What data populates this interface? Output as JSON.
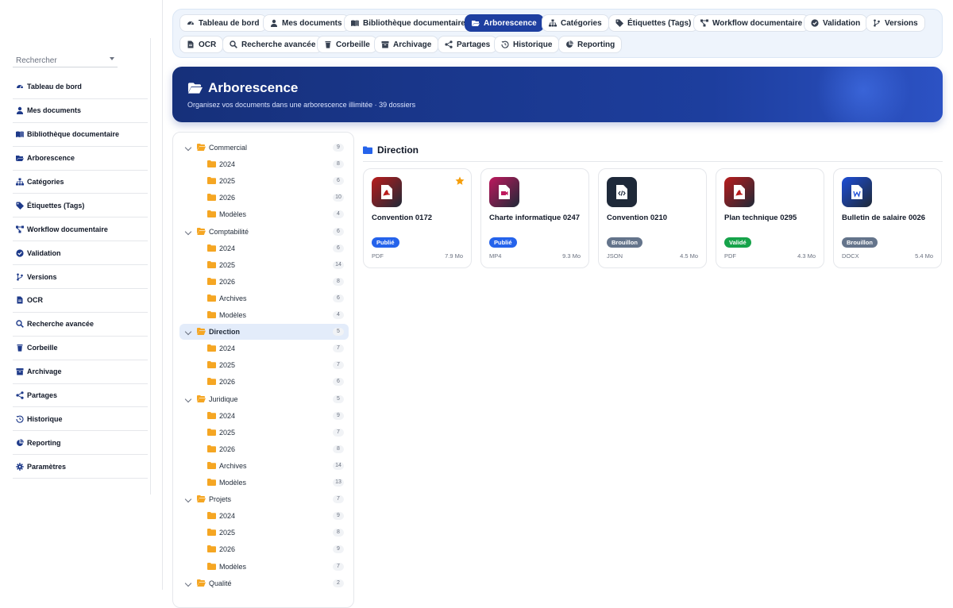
{
  "colors": {
    "accent": "#1e3fa0",
    "folder": "#f5a623",
    "published": "#2563eb",
    "draft": "#64748b",
    "validated": "#16a34a"
  },
  "sidebar": {
    "search_placeholder": "Rechercher",
    "items": [
      {
        "label": "Tableau de bord",
        "icon": "dashboard-icon"
      },
      {
        "label": "Mes documents",
        "icon": "user-icon"
      },
      {
        "label": "Bibliothèque documentaire",
        "icon": "book-icon"
      },
      {
        "label": "Arborescence",
        "icon": "folder-open-icon"
      },
      {
        "label": "Catégories",
        "icon": "sitemap-icon"
      },
      {
        "label": "Étiquettes (Tags)",
        "icon": "tag-icon"
      },
      {
        "label": "Workflow documentaire",
        "icon": "workflow-icon"
      },
      {
        "label": "Validation",
        "icon": "check-circle-icon"
      },
      {
        "label": "Versions",
        "icon": "branch-icon"
      },
      {
        "label": "OCR",
        "icon": "file-text-icon"
      },
      {
        "label": "Recherche avancée",
        "icon": "search-icon"
      },
      {
        "label": "Corbeille",
        "icon": "trash-icon"
      },
      {
        "label": "Archivage",
        "icon": "archive-icon"
      },
      {
        "label": "Partages",
        "icon": "share-icon"
      },
      {
        "label": "Historique",
        "icon": "history-icon"
      },
      {
        "label": "Reporting",
        "icon": "pie-chart-icon"
      },
      {
        "label": "Paramètres",
        "icon": "gear-icon"
      }
    ]
  },
  "tabs": [
    {
      "label": "Tableau de bord",
      "icon": "dashboard-icon"
    },
    {
      "label": "Mes documents",
      "icon": "user-icon"
    },
    {
      "label": "Bibliothèque documentaire",
      "icon": "book-icon"
    },
    {
      "label": "Arborescence",
      "icon": "folder-open-icon",
      "active": true
    },
    {
      "label": "Catégories",
      "icon": "sitemap-icon"
    },
    {
      "label": "Étiquettes (Tags)",
      "icon": "tag-icon"
    },
    {
      "label": "Workflow documentaire",
      "icon": "workflow-icon"
    },
    {
      "label": "Validation",
      "icon": "check-circle-icon"
    },
    {
      "label": "Versions",
      "icon": "branch-icon"
    },
    {
      "label": "OCR",
      "icon": "file-text-icon"
    },
    {
      "label": "Recherche avancée",
      "icon": "search-icon"
    },
    {
      "label": "Corbeille",
      "icon": "trash-icon"
    },
    {
      "label": "Archivage",
      "icon": "archive-icon"
    },
    {
      "label": "Partages",
      "icon": "share-icon"
    },
    {
      "label": "Historique",
      "icon": "history-icon"
    },
    {
      "label": "Reporting",
      "icon": "pie-chart-icon"
    }
  ],
  "hero": {
    "title": "Arborescence",
    "subtitle": "Organisez vos documents dans une arborescence illimitée · 39 dossiers"
  },
  "tree": [
    {
      "label": "Commercial",
      "count": "9",
      "level": 0
    },
    {
      "label": "2024",
      "count": "8",
      "level": 1
    },
    {
      "label": "2025",
      "count": "6",
      "level": 1
    },
    {
      "label": "2026",
      "count": "10",
      "level": 1
    },
    {
      "label": "Modèles",
      "count": "4",
      "level": 1
    },
    {
      "label": "Comptabilité",
      "count": "6",
      "level": 0
    },
    {
      "label": "2024",
      "count": "6",
      "level": 1
    },
    {
      "label": "2025",
      "count": "14",
      "level": 1
    },
    {
      "label": "2026",
      "count": "8",
      "level": 1
    },
    {
      "label": "Archives",
      "count": "6",
      "level": 1
    },
    {
      "label": "Modèles",
      "count": "4",
      "level": 1
    },
    {
      "label": "Direction",
      "count": "5",
      "level": 0,
      "selected": true
    },
    {
      "label": "2024",
      "count": "7",
      "level": 1
    },
    {
      "label": "2025",
      "count": "7",
      "level": 1
    },
    {
      "label": "2026",
      "count": "6",
      "level": 1
    },
    {
      "label": "Juridique",
      "count": "5",
      "level": 0
    },
    {
      "label": "2024",
      "count": "9",
      "level": 1
    },
    {
      "label": "2025",
      "count": "7",
      "level": 1
    },
    {
      "label": "2026",
      "count": "8",
      "level": 1
    },
    {
      "label": "Archives",
      "count": "14",
      "level": 1
    },
    {
      "label": "Modèles",
      "count": "13",
      "level": 1
    },
    {
      "label": "Projets",
      "count": "7",
      "level": 0
    },
    {
      "label": "2024",
      "count": "9",
      "level": 1
    },
    {
      "label": "2025",
      "count": "8",
      "level": 1
    },
    {
      "label": "2026",
      "count": "9",
      "level": 1
    },
    {
      "label": "Modèles",
      "count": "7",
      "level": 1
    },
    {
      "label": "Qualité",
      "count": "2",
      "level": 0
    }
  ],
  "content": {
    "title": "Direction",
    "cards": [
      {
        "name": "Convention 0172",
        "status": "Publié",
        "status_color": "#2563eb",
        "ext": "PDF",
        "size": "7.9 Mo",
        "icon": "pdf-icon",
        "icon_bg": "#b91c1c",
        "starred": true
      },
      {
        "name": "Charte informatique 0247",
        "status": "Publié",
        "status_color": "#2563eb",
        "ext": "MP4",
        "size": "9.3 Mo",
        "icon": "video-icon",
        "icon_bg": "#be185d",
        "starred": false
      },
      {
        "name": "Convention 0210",
        "status": "Brouillon",
        "status_color": "#64748b",
        "ext": "JSON",
        "size": "4.5 Mo",
        "icon": "code-icon",
        "icon_bg": "#1e293b",
        "starred": false
      },
      {
        "name": "Plan technique 0295",
        "status": "Validé",
        "status_color": "#16a34a",
        "ext": "PDF",
        "size": "4.3 Mo",
        "icon": "pdf-icon",
        "icon_bg": "#b91c1c",
        "starred": false
      },
      {
        "name": "Bulletin de salaire 0026",
        "status": "Brouillon",
        "status_color": "#64748b",
        "ext": "DOCX",
        "size": "5.4 Mo",
        "icon": "word-icon",
        "icon_bg": "#1d4ed8",
        "starred": false
      }
    ]
  }
}
